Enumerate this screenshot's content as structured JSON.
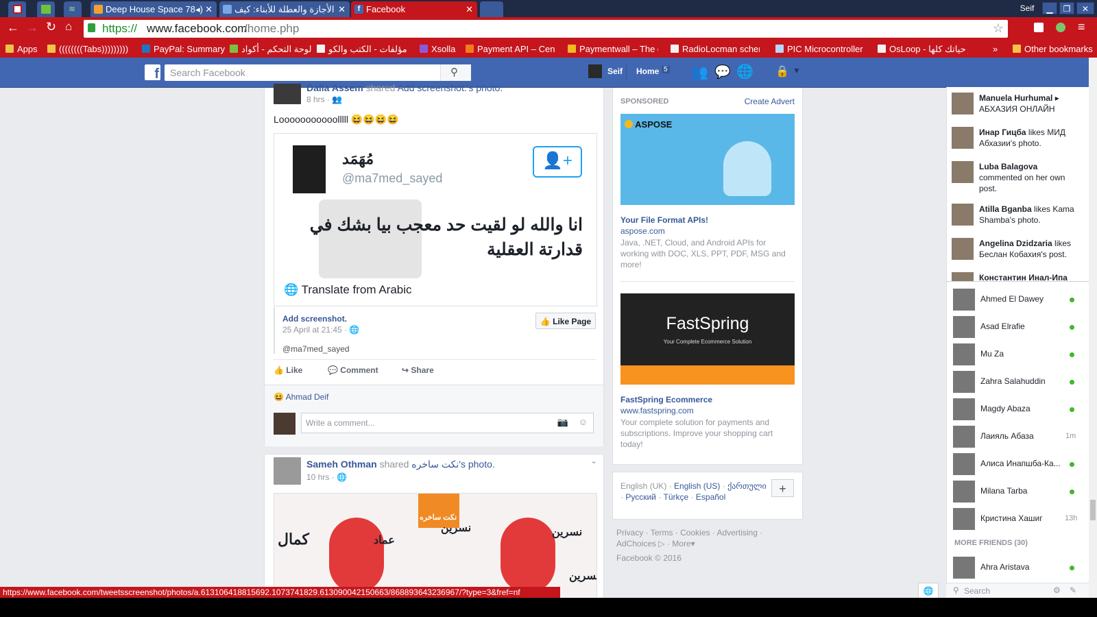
{
  "browser": {
    "tabs": [
      {
        "title": "Deep House Space 78",
        "color": "#f4a030"
      },
      {
        "title": "الأجازة والعطلة للأبناء: كيف",
        "color": "#4267b2"
      },
      {
        "title": "Facebook",
        "color": "#4267b2"
      }
    ],
    "profile_name": "Seif",
    "url_secure": "https://",
    "url_host": "www.facebook.com",
    "url_path": "/home.php",
    "bookmarks": [
      "Apps",
      "((((((((Tabs)))))))))",
      "PayPal: Summary",
      "لوحة التحكم - أكواد",
      "مؤلفات - الكتب والكو",
      "Xsolla",
      "Payment API – Centi",
      "Paymentwall – The e",
      "RadioLocman schem",
      "PIC Microcontroller f",
      "OsLoop - يبر حياتك كلها"
    ],
    "other_bookmarks": "Other bookmarks",
    "chevron": "»"
  },
  "fb": {
    "search_placeholder": "Search Facebook",
    "user_name": "Seif",
    "home_label": "Home",
    "home_count": "5"
  },
  "post1": {
    "author": "Dalia Assem",
    "shared_text": "shared",
    "shared_page": "Add screenshot.",
    "shared_suffix": "'s photo.",
    "time": "8 hrs",
    "text": "Looooooooooolllll 😆😆😆😆",
    "tweet_name": "مُهَمَد",
    "tweet_handle": "@ma7med_sayed",
    "tweet_text": "انا والله لو لقيت حد معجب بيا بشك في قدارتة العقلية",
    "translate": "Translate from Arabic",
    "page_name": "Add screenshot.",
    "page_date": "25 April at 21:45",
    "page_handle": "@ma7med_sayed",
    "like_page": "Like Page",
    "actions": [
      "Like",
      "Comment",
      "Share"
    ],
    "reactor": "Ahmad Deif",
    "comment_placeholder": "Write a comment..."
  },
  "post2": {
    "author": "Sameh Othman",
    "shared_text": "shared",
    "shared_page": "نكت ساخره",
    "shared_suffix": "'s photo.",
    "time": "10 hrs",
    "labels": [
      "كمال",
      "عماد",
      "نسرين",
      "نسرين",
      "نسرين",
      "نكت ساخره"
    ]
  },
  "sponsored": {
    "heading": "SPONSORED",
    "create_advert": "Create Advert",
    "ads": [
      {
        "brand": "ASPOSE",
        "title": "Your File Format APIs!",
        "domain": "aspose.com",
        "desc": "Java, .NET, Cloud, and Android APIs for working with DOC, XLS, PPT, PDF, MSG and more!"
      },
      {
        "brand": "FastSpring",
        "tagline": "Your Complete Ecommerce Solution",
        "title": "FastSpring Ecommerce",
        "domain": "www.fastspring.com",
        "desc": "Your complete solution for payments and subscriptions. Improve your shopping cart today!"
      }
    ]
  },
  "languages": {
    "items": [
      "English (UK)",
      "English (US)",
      "ქართული",
      "Русский",
      "Türkçe",
      "Español"
    ],
    "plus": "+"
  },
  "footer": {
    "links": [
      "Privacy",
      "Terms",
      "Cookies",
      "Advertising",
      "AdChoices",
      "More"
    ],
    "copyright": "Facebook © 2016"
  },
  "ticker": [
    {
      "name": "Manuela Hurhumal",
      "rest": "▸ АБХАЗИЯ ОНЛАЙН"
    },
    {
      "name": "Инар Гицба",
      "rest": "likes МИД Абхазии's photo."
    },
    {
      "name": "Luba Balagova",
      "rest": "commented on her own post."
    },
    {
      "name": "Atilla Bganba",
      "rest": "likes Kama Shamba's photo."
    },
    {
      "name": "Angelina Dzidzaria",
      "rest": "likes Беслан Кобахия's post."
    },
    {
      "name": "Константин Инал-Ипа",
      "rest": ""
    }
  ],
  "chat": {
    "online": [
      {
        "name": "Ahmed El Dawey",
        "status": ""
      },
      {
        "name": "Asad Elrafie",
        "status": ""
      },
      {
        "name": "Mu Za",
        "status": ""
      },
      {
        "name": "Zahra Salahuddin",
        "status": ""
      },
      {
        "name": "Magdy Abaza",
        "status": ""
      },
      {
        "name": "Лаияль Абаза",
        "status": "1m"
      },
      {
        "name": "Алиса Инапшба-Ка...",
        "status": ""
      },
      {
        "name": "Milana Tarba",
        "status": ""
      },
      {
        "name": "Кристина Хашиг",
        "status": "13h"
      }
    ],
    "more_friends": "MORE FRIENDS (30)",
    "more": [
      {
        "name": "Ahra Aristava"
      }
    ],
    "search_placeholder": "Search"
  },
  "status_url": "https://www.facebook.com/tweetsscreenshot/photos/a.613106418815692.1073741829.613090042150663/868893643236967/?type=3&fref=nf"
}
